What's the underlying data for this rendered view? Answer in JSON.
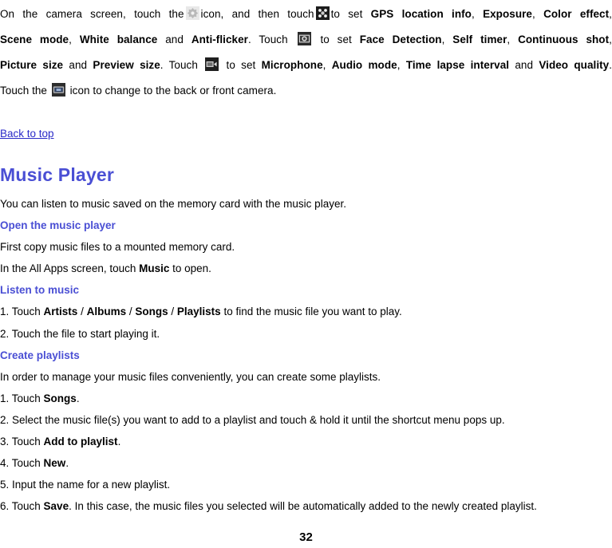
{
  "document": {
    "page_number": "32",
    "colors": {
      "heading": "#4a4fd4",
      "subheading": "#4a4fd4",
      "link": "#2b2bc8",
      "body_text": "#000000",
      "background": "#ffffff"
    }
  },
  "camera_paragraph": {
    "line1": {
      "before_icon1": "On the camera screen, touch the",
      "icon1": "camera-settings-light-icon",
      "mid1": "icon, and then touch",
      "icon2": "camera-settings-dark-icon",
      "mid2": "to set",
      "bold1": "GPS location info",
      "sep1": ",",
      "bold2": "Exposure",
      "sep2": ",",
      "bold3": "Color effect",
      "sep3": ","
    },
    "line2": {
      "bold1": "Scene mode",
      "sep1": ",",
      "bold2": "White balance",
      "mid1": "and",
      "bold3": "Anti-flicker",
      "mid2": ". Touch",
      "icon3": "photo-camera-icon",
      "mid3": "to set",
      "bold4": "Face Detection",
      "sep2": ",",
      "bold5": "Self timer",
      "sep3": ",",
      "bold6": "Continuous shot",
      "sep4": ","
    },
    "line3": {
      "bold1": "Picture size",
      "mid1": "and",
      "bold2": "Preview size",
      "mid2": ". Touch",
      "icon4": "video-camera-icon",
      "mid3": "to set",
      "bold3": "Microphone",
      "sep1": ",",
      "bold4": "Audio mode",
      "sep2": ",",
      "bold5": "Time lapse interval",
      "mid4": "and",
      "bold6": "Video quality",
      "sep3": "."
    },
    "line4": {
      "before_icon": "Touch the",
      "icon5": "switch-camera-icon",
      "after_icon": "icon to change to the back or front camera."
    }
  },
  "back_to_top": {
    "label": "Back to top"
  },
  "music_player": {
    "heading": "Music Player",
    "intro": "You can listen to music saved on the memory card with the music player.",
    "sections": [
      {
        "subheading": "Open the music player",
        "lines": [
          {
            "text": "First copy music files to a mounted memory card."
          },
          {
            "prefix": "In the All Apps screen, touch ",
            "bold": "Music",
            "suffix": " to open."
          }
        ]
      },
      {
        "subheading": "Listen to music",
        "lines": [
          {
            "prefix": "1. Touch ",
            "bold": "Artists",
            "mid1": " / ",
            "bold2": "Albums",
            "mid2": " / ",
            "bold3": "Songs",
            "mid3": " / ",
            "bold4": "Playlists",
            "suffix": " to find the music file you want to play."
          },
          {
            "text": "2. Touch the file to start playing it."
          }
        ]
      },
      {
        "subheading": "Create playlists",
        "lines": [
          {
            "text": "In order to manage your music files conveniently, you can create some playlists."
          },
          {
            "prefix": "1. Touch ",
            "bold": "Songs",
            "suffix": "."
          },
          {
            "text": "2. Select the music file(s) you want to add to a playlist and touch & hold it until the shortcut menu pops up."
          },
          {
            "prefix": "3. Touch ",
            "bold": "Add to playlist",
            "suffix": "."
          },
          {
            "prefix": "4. Touch ",
            "bold": "New",
            "suffix": "."
          },
          {
            "text": "5. Input the name for a new playlist."
          },
          {
            "prefix": "6. Touch ",
            "bold": "Save",
            "suffix": ". In this case, the music files you selected will be automatically added to the newly created playlist."
          }
        ]
      }
    ]
  }
}
